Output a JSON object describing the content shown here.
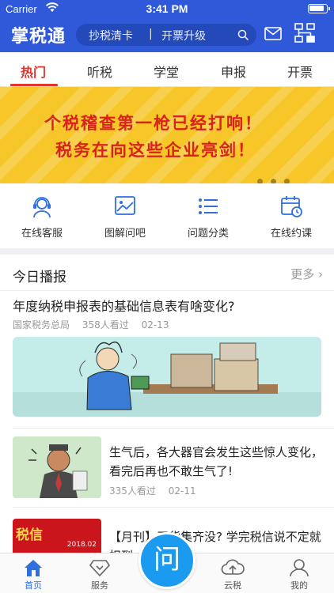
{
  "status_bar": {
    "carrier": "Carrier",
    "time": "3:41 PM"
  },
  "header": {
    "brand": "掌税通",
    "search_left": "抄税清卡",
    "search_sep": "|",
    "search_right": "开票升级",
    "icons": [
      "search-icon",
      "mail-icon",
      "org-chart-icon"
    ]
  },
  "tabs": [
    {
      "label": "热门",
      "active": true
    },
    {
      "label": "听税",
      "active": false
    },
    {
      "label": "学堂",
      "active": false
    },
    {
      "label": "申报",
      "active": false
    },
    {
      "label": "开票",
      "active": false
    }
  ],
  "banner": {
    "line1": "个税稽查第一枪已经打响！",
    "line2": "税务在向这些企业亮剑！",
    "slide_count": 3,
    "bg_color": "#f7c628",
    "text_color": "#d8231c"
  },
  "quick": [
    {
      "label": "在线客服",
      "icon": "headset-icon"
    },
    {
      "label": "图解问吧",
      "icon": "picture-icon"
    },
    {
      "label": "问题分类",
      "icon": "list-icon"
    },
    {
      "label": "在线约课",
      "icon": "calendar-clock-icon"
    }
  ],
  "news": {
    "title": "今日播报",
    "more": "更多 ›",
    "articles": [
      {
        "title": "年度纳税申报表的基础信息表有啥变化?",
        "source": "国家税务总局",
        "views": "358人看过",
        "date": "02-13"
      },
      {
        "title": "生气后，各大器官会发生这些惊人变化，看完后再也不敢生气了!",
        "views": "335人看过",
        "date": "02-11"
      },
      {
        "title": "【月刊】干货集齐没? 学完税信说不定就扣到...",
        "thumb_title": "税信",
        "thumb_date": "2018.02"
      }
    ]
  },
  "tabbar": [
    {
      "label": "首页",
      "icon": "home-icon",
      "active": true
    },
    {
      "label": "服务",
      "icon": "diamond-icon",
      "active": false
    },
    {
      "label": "问",
      "icon": "ask-button",
      "active": false
    },
    {
      "label": "云税",
      "icon": "cloud-icon",
      "active": false
    },
    {
      "label": "我的",
      "icon": "person-icon",
      "active": false
    }
  ],
  "colors": {
    "primary": "#2f59d9",
    "accent_red": "#e0332e",
    "ask_blue": "#1b9bf0"
  }
}
